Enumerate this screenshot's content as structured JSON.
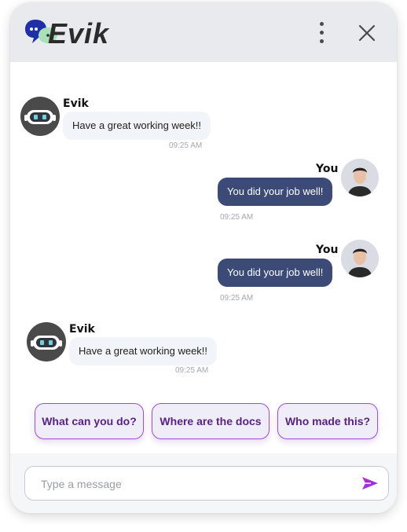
{
  "header": {
    "logo_text": "Evik",
    "menu_icon": "more-vertical-icon",
    "close_icon": "close-icon"
  },
  "messages": [
    {
      "sender": "Evik",
      "text": "Have a great working week!!",
      "time": "09:25 AM",
      "from_bot": true
    },
    {
      "sender": "You",
      "text": "You did your job well!",
      "time": "09:25 AM",
      "from_bot": false
    },
    {
      "sender": "You",
      "text": "You did your job well!",
      "time": "09:25 AM",
      "from_bot": false
    },
    {
      "sender": "Evik",
      "text": "Have a great working week!!",
      "time": "09:25 AM",
      "from_bot": true
    }
  ],
  "quick_replies": [
    "What can you do?",
    "Where are the docs",
    "Who made this?"
  ],
  "composer": {
    "placeholder": "Type a message",
    "value": "",
    "send_icon": "send-icon"
  },
  "colors": {
    "header_bg": "#e9eaee",
    "user_bubble": "#3c4a78",
    "bot_bubble": "#f1f4f8",
    "accent": "#a04cd8",
    "logo_blue": "#1e2fa8",
    "logo_green": "#a8e0b8"
  }
}
